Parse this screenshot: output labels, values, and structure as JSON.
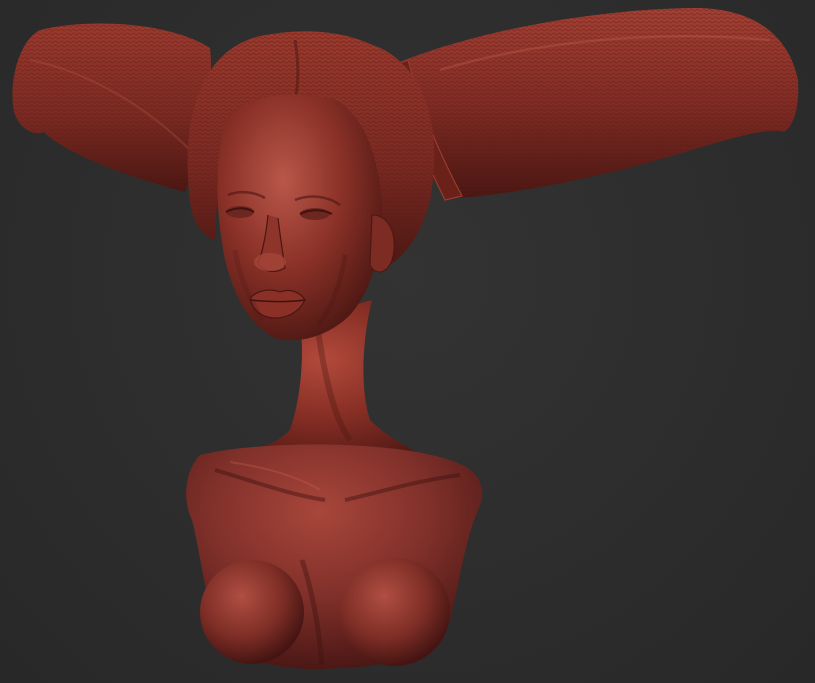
{
  "scene": {
    "background_color": "#2b2b2b",
    "material_color": "#7a2a22",
    "highlight_color": "#b8574a",
    "shadow_color": "#3e1210",
    "subject": "sculpted bust"
  }
}
